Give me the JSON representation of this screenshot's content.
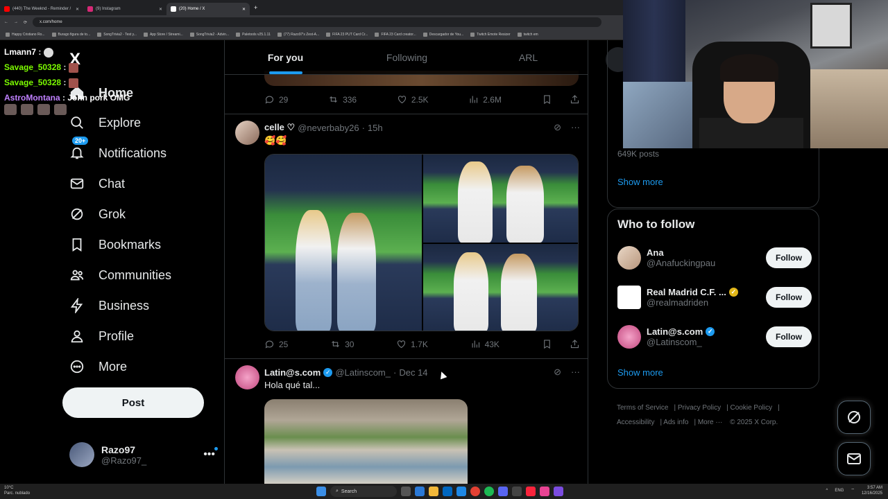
{
  "browser": {
    "tabs": [
      {
        "title": "(440) The Weeknd - Reminder /",
        "color": "#ff0000"
      },
      {
        "title": "(9) Instagram",
        "color": "#d62976"
      },
      {
        "title": "(20) Home / X",
        "color": "#ffffff"
      }
    ],
    "url": "x.com/home",
    "bookmarks": [
      "Happy Cristiano Ro...",
      "Burago figura de to...",
      "SongTrivia2 - Test y...",
      "App Store / Streami...",
      "SongTrivia2 - Advin...",
      "Paletools v25.1.11",
      "(77) Razo97's Zest-A...",
      "FIFA 23 PUT Card Cr...",
      "FIFA 23 Card creator...",
      "Descargador de You...",
      "Twitch Emote Resizer",
      "twitch em"
    ]
  },
  "chat_overlay": [
    {
      "user": "Lmann7",
      "msg": ""
    },
    {
      "user": "Savage_50328",
      "msg": ""
    },
    {
      "user": "Savage_50328",
      "msg": ""
    },
    {
      "user": "AstroMontana",
      "msg": "John pork OMG"
    }
  ],
  "nav": {
    "logo": "X",
    "items": [
      {
        "label": "Home",
        "icon": "home-icon"
      },
      {
        "label": "Explore",
        "icon": "search-icon"
      },
      {
        "label": "Notifications",
        "icon": "bell-icon",
        "badge": "20+"
      },
      {
        "label": "Chat",
        "icon": "mail-icon"
      },
      {
        "label": "Grok",
        "icon": "grok-icon"
      },
      {
        "label": "Bookmarks",
        "icon": "bookmark-icon"
      },
      {
        "label": "Communities",
        "icon": "people-icon"
      },
      {
        "label": "Business",
        "icon": "lightning-icon"
      },
      {
        "label": "Profile",
        "icon": "person-icon"
      },
      {
        "label": "More",
        "icon": "more-circle-icon"
      }
    ],
    "post_label": "Post",
    "account": {
      "name": "Razo97",
      "handle": "@Razo97_"
    }
  },
  "timeline": {
    "tabs": [
      "For you",
      "Following",
      "ARL"
    ],
    "tweet0_stats": {
      "replies": "29",
      "reposts": "336",
      "likes": "2.5K",
      "views": "2.6M"
    },
    "tweet1": {
      "name": "celle ♡",
      "handle": "@neverbaby26",
      "time": "15h",
      "text": "🥰🥰",
      "stats": {
        "replies": "25",
        "reposts": "30",
        "likes": "1.7K",
        "views": "43K"
      }
    },
    "tweet2": {
      "name": "Latin@s.com",
      "handle": "@Latinscom_",
      "time": "Dec 14",
      "text": "Hola qué tal..."
    }
  },
  "right": {
    "trend_posts": "649K posts",
    "show_more": "Show more",
    "who_to_follow_title": "Who to follow",
    "suggestions": [
      {
        "name": "Ana",
        "handle": "@Anafuckingpau",
        "verified": false
      },
      {
        "name": "Real Madrid C.F. ...",
        "handle": "@realmadriden",
        "verified": true
      },
      {
        "name": "Latin@s.com",
        "handle": "@Latinscom_",
        "verified": true
      }
    ],
    "follow_label": "Follow",
    "footer": [
      "Terms of Service",
      "Privacy Policy",
      "Cookie Policy",
      "Accessibility",
      "Ads info",
      "More ···",
      "© 2025 X Corp."
    ]
  },
  "taskbar": {
    "weather_temp": "10°C",
    "weather_desc": "Parc. nublado",
    "search": "Search",
    "lang": "ENG",
    "time": "3:57 AM",
    "date": "12/16/2025"
  },
  "colors": {
    "accent": "#1d9bf0",
    "bg": "#000000",
    "border": "#2f3336",
    "muted": "#71767b"
  }
}
